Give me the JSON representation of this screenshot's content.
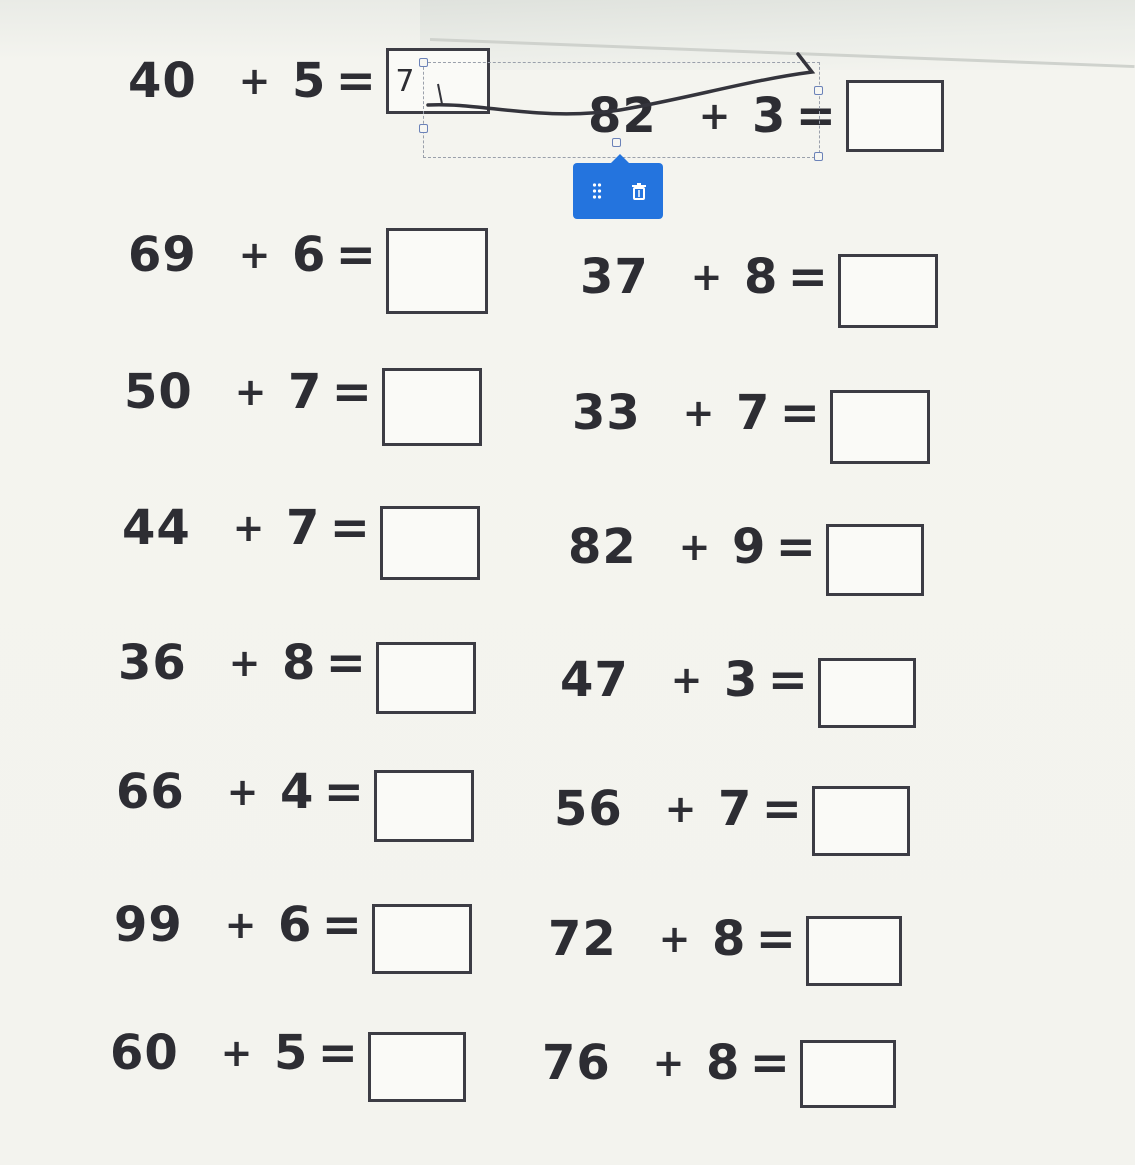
{
  "worksheet": {
    "rows": [
      {
        "left": {
          "a": "40",
          "op": "+",
          "b": "5",
          "eq": "=",
          "answer": "7"
        },
        "right": {
          "a": "82",
          "op": "+",
          "b": "3",
          "eq": "=",
          "answer": ""
        }
      },
      {
        "left": {
          "a": "69",
          "op": "+",
          "b": "6",
          "eq": "=",
          "answer": ""
        },
        "right": {
          "a": "37",
          "op": "+",
          "b": "8",
          "eq": "=",
          "answer": ""
        }
      },
      {
        "left": {
          "a": "50",
          "op": "+",
          "b": "7",
          "eq": "=",
          "answer": ""
        },
        "right": {
          "a": "33",
          "op": "+",
          "b": "7",
          "eq": "=",
          "answer": ""
        }
      },
      {
        "left": {
          "a": "44",
          "op": "+",
          "b": "7",
          "eq": "=",
          "answer": ""
        },
        "right": {
          "a": "82",
          "op": "+",
          "b": "9",
          "eq": "=",
          "answer": ""
        }
      },
      {
        "left": {
          "a": "36",
          "op": "+",
          "b": "8",
          "eq": "=",
          "answer": ""
        },
        "right": {
          "a": "47",
          "op": "+",
          "b": "3",
          "eq": "=",
          "answer": ""
        }
      },
      {
        "left": {
          "a": "66",
          "op": "+",
          "b": "4",
          "eq": "=",
          "answer": ""
        },
        "right": {
          "a": "56",
          "op": "+",
          "b": "7",
          "eq": "=",
          "answer": ""
        }
      },
      {
        "left": {
          "a": "99",
          "op": "+",
          "b": "6",
          "eq": "=",
          "answer": ""
        },
        "right": {
          "a": "72",
          "op": "+",
          "b": "8",
          "eq": "=",
          "answer": ""
        }
      },
      {
        "left": {
          "a": "60",
          "op": "+",
          "b": "5",
          "eq": "=",
          "answer": ""
        },
        "right": {
          "a": "76",
          "op": "+",
          "b": "8",
          "eq": "=",
          "answer": ""
        }
      }
    ]
  },
  "block_toolbar": {
    "icons": [
      "drag-handle-icon",
      "trash-icon"
    ]
  },
  "colors": {
    "toolbar": "#2474de",
    "text": "#2d2d33",
    "handle": "#6b82b8"
  }
}
